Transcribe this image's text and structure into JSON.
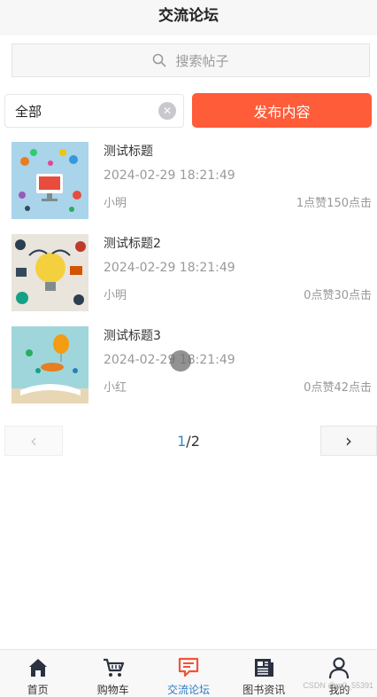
{
  "header": {
    "title": "交流论坛"
  },
  "search": {
    "placeholder": "搜索帖子"
  },
  "filter": {
    "value": "全部"
  },
  "publish": {
    "label": "发布内容"
  },
  "posts": [
    {
      "title": "测试标题",
      "time": "2024-02-29 18:21:49",
      "author": "小明",
      "stats": "1点赞150点击"
    },
    {
      "title": "测试标题2",
      "time": "2024-02-29 18:21:49",
      "author": "小明",
      "stats": "0点赞30点击"
    },
    {
      "title": "测试标题3",
      "time": "2024-02-29 18:21:49",
      "author": "小红",
      "stats": "0点赞42点击"
    }
  ],
  "pager": {
    "current": "1",
    "total": "/2"
  },
  "tabs": [
    {
      "label": "首页",
      "icon": "home-icon"
    },
    {
      "label": "购物车",
      "icon": "cart-icon"
    },
    {
      "label": "交流论坛",
      "icon": "forum-icon"
    },
    {
      "label": "图书资讯",
      "icon": "news-icon"
    },
    {
      "label": "我的",
      "icon": "user-icon"
    }
  ],
  "watermark": "CSDN @m0_55391",
  "colors": {
    "accent": "#ff5c39",
    "active_tab": "#2b7cc7"
  }
}
